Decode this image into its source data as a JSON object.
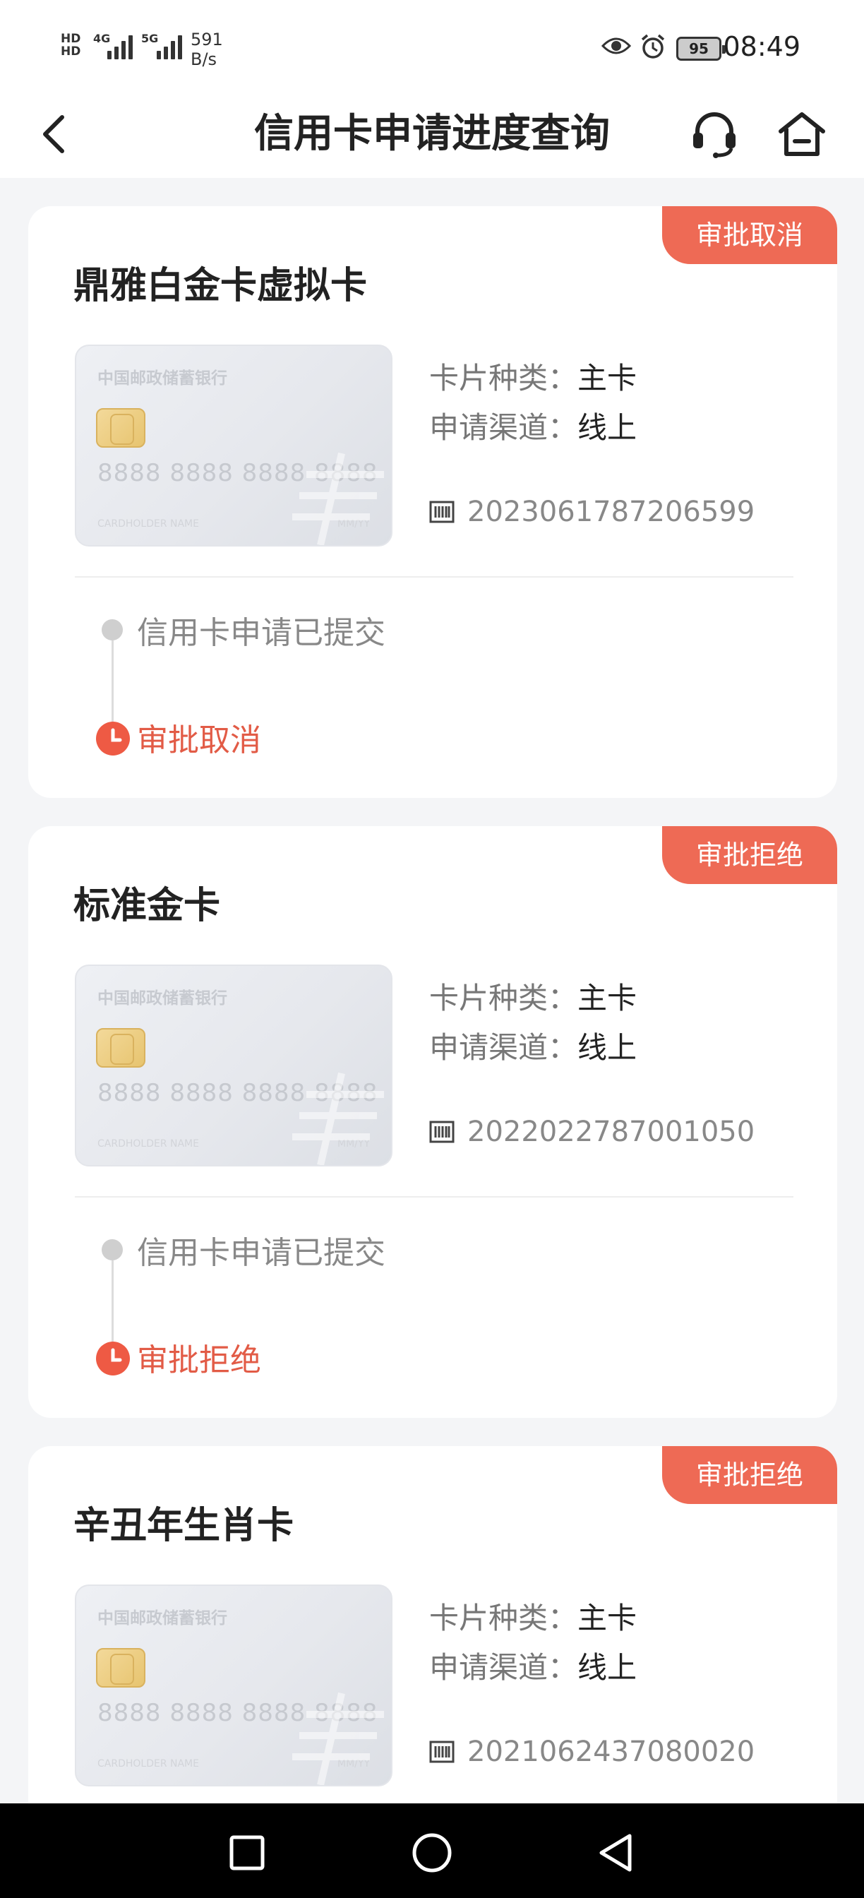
{
  "status_bar": {
    "hd1": "HD",
    "hd2": "HD",
    "net1": "4G",
    "net2": "5G",
    "speed_value": "591",
    "speed_unit": "B/s",
    "battery": "95",
    "time": "08:49"
  },
  "header": {
    "title": "信用卡申请进度查询"
  },
  "field_labels": {
    "card_type": "卡片种类：",
    "channel": "申请渠道："
  },
  "card_art": {
    "bank": "中国邮政储蓄银行",
    "number": "8888 8888 8888 8888",
    "holder": "CARDHOLDER NAME",
    "expiry": "MM/YY"
  },
  "applications": [
    {
      "status": "审批取消",
      "name": "鼎雅白金卡虚拟卡",
      "card_type": "主卡",
      "channel": "线上",
      "application_no": "2023061787206599",
      "steps": [
        "信用卡申请已提交",
        "审批取消"
      ]
    },
    {
      "status": "审批拒绝",
      "name": "标准金卡",
      "card_type": "主卡",
      "channel": "线上",
      "application_no": "2022022787001050",
      "steps": [
        "信用卡申请已提交",
        "审批拒绝"
      ]
    },
    {
      "status": "审批拒绝",
      "name": "辛丑年生肖卡",
      "card_type": "主卡",
      "channel": "线上",
      "application_no": "2021062437080020",
      "steps": []
    }
  ],
  "colors": {
    "accent": "#ee6a55",
    "status_text": "#e25b46",
    "background": "#f4f5f7"
  },
  "icons": {
    "back": "back-arrow-icon",
    "support": "headset-icon",
    "home": "home-icon",
    "nav_recents": "square-icon",
    "nav_home": "circle-icon",
    "nav_back": "triangle-back-icon"
  }
}
